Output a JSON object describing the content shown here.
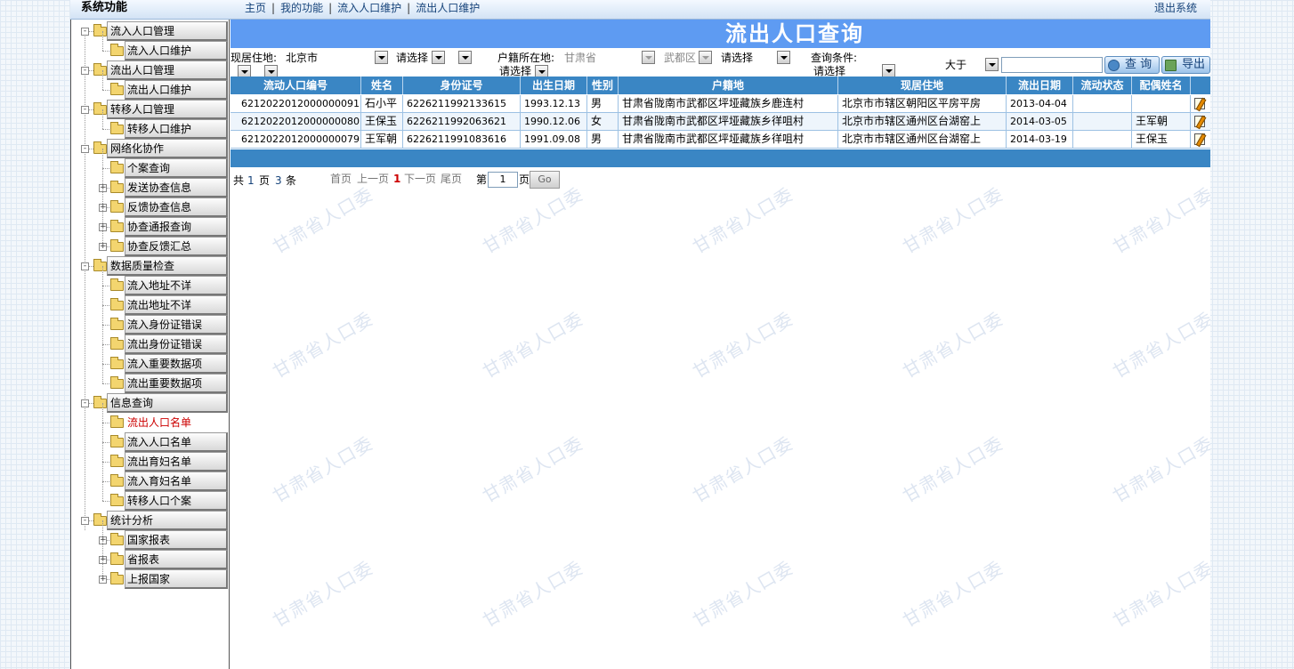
{
  "header": {
    "system_title": "系统功能",
    "nav": [
      "主页",
      "我的功能",
      "流入人口维护",
      "流出人口维护"
    ],
    "nav_sep": "|",
    "logout": "退出系统"
  },
  "sidebar": {
    "items": [
      {
        "label": "流入人口管理",
        "level": 0,
        "toggle": "-"
      },
      {
        "label": "流入人口维护",
        "level": 1
      },
      {
        "label": "流出人口管理",
        "level": 0,
        "toggle": "-"
      },
      {
        "label": "流出人口维护",
        "level": 1
      },
      {
        "label": "转移人口管理",
        "level": 0,
        "toggle": "-"
      },
      {
        "label": "转移人口维护",
        "level": 1
      },
      {
        "label": "网络化协作",
        "level": 0,
        "toggle": "-"
      },
      {
        "label": "个案查询",
        "level": 1
      },
      {
        "label": "发送协查信息",
        "level": 1,
        "toggle": "+"
      },
      {
        "label": "反馈协查信息",
        "level": 1,
        "toggle": "+"
      },
      {
        "label": "协查通报查询",
        "level": 1,
        "toggle": "+"
      },
      {
        "label": "协查反馈汇总",
        "level": 1,
        "toggle": "+"
      },
      {
        "label": "数据质量检查",
        "level": 0,
        "toggle": "-"
      },
      {
        "label": "流入地址不详",
        "level": 1
      },
      {
        "label": "流出地址不详",
        "level": 1
      },
      {
        "label": "流入身份证错误",
        "level": 1
      },
      {
        "label": "流出身份证错误",
        "level": 1
      },
      {
        "label": "流入重要数据项",
        "level": 1
      },
      {
        "label": "流出重要数据项",
        "level": 1
      },
      {
        "label": "信息查询",
        "level": 0,
        "toggle": "-"
      },
      {
        "label": "流出人口名单",
        "level": 1,
        "active": true
      },
      {
        "label": "流入人口名单",
        "level": 1
      },
      {
        "label": "流出育妇名单",
        "level": 1
      },
      {
        "label": "流入育妇名单",
        "level": 1
      },
      {
        "label": "转移人口个案",
        "level": 1
      },
      {
        "label": "统计分析",
        "level": 0,
        "toggle": "-"
      },
      {
        "label": "国家报表",
        "level": 1,
        "toggle": "+"
      },
      {
        "label": "省报表",
        "level": 1,
        "toggle": "+"
      },
      {
        "label": "上报国家",
        "level": 1,
        "toggle": "+"
      }
    ]
  },
  "main": {
    "title": "流出人口查询",
    "filters": {
      "current_residence_label": "现居住地:",
      "current_residence_value": "北京市",
      "select_placeholder": "请选择",
      "hukou_label": "户籍所在地:",
      "hukou_province": "甘肃省",
      "hukou_district": "武都区",
      "condition_label": "查询条件:",
      "condition_value": "请选择",
      "operator": "大于",
      "query_input": ""
    },
    "buttons": {
      "query": "查 询",
      "export": "导出"
    },
    "table": {
      "headers": [
        "流动人口编号",
        "姓名",
        "身份证号",
        "出生日期",
        "性别",
        "户籍地",
        "现居住地",
        "流出日期",
        "流动状态",
        "配偶姓名"
      ],
      "rows": [
        [
          "6212022012000000091",
          "石小平",
          "6226211992133615",
          "1993.12.13",
          "男",
          "甘肃省陇南市武都区坪垭藏族乡鹿连村",
          "北京市市辖区朝阳区平房平房",
          "2013-04-04",
          "",
          ""
        ],
        [
          "6212022012000000080",
          "王保玉",
          "6226211992063621",
          "1990.12.06",
          "女",
          "甘肃省陇南市武都区坪垭藏族乡徉咀村",
          "北京市市辖区通州区台湖窑上",
          "2014-03-05",
          "",
          "王军朝"
        ],
        [
          "6212022012000000079",
          "王军朝",
          "6226211991083616",
          "1991.09.08",
          "男",
          "甘肃省陇南市武都区坪垭藏族乡徉咀村",
          "北京市市辖区通州区台湖窑上",
          "2014-03-19",
          "",
          "王保玉"
        ]
      ]
    },
    "pager": {
      "total_prefix": "共",
      "total_pages": "1",
      "page_unit": "页",
      "total_records": "3",
      "record_unit": "条",
      "first": "首页",
      "prev": "上一页",
      "current": "1",
      "next": "下一页",
      "last": "尾页",
      "goto_prefix": "第",
      "goto_value": "1",
      "goto_suffix": "页",
      "go": "Go"
    },
    "watermark": "甘肃省人口委"
  }
}
